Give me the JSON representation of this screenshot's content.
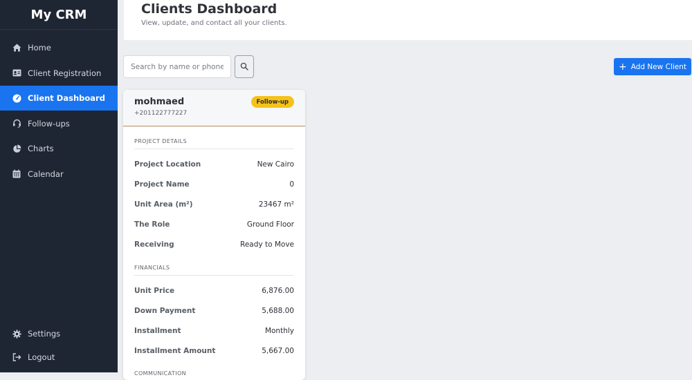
{
  "app": {
    "brand": "My CRM"
  },
  "sidebar": {
    "items": [
      {
        "label": "Home",
        "icon": "home-icon"
      },
      {
        "label": "Client Registration",
        "icon": "id-card-icon"
      },
      {
        "label": "Client Dashboard",
        "icon": "dashboard-icon",
        "active": true
      },
      {
        "label": "Follow-ups",
        "icon": "headset-icon"
      },
      {
        "label": "Charts",
        "icon": "pie-chart-icon"
      },
      {
        "label": "Calendar",
        "icon": "calendar-icon"
      }
    ],
    "bottom": [
      {
        "label": "Settings",
        "icon": "gear-icon"
      },
      {
        "label": "Logout",
        "icon": "logout-icon"
      }
    ]
  },
  "header": {
    "title": "Clients Dashboard",
    "subtitle": "View, update, and contact all your clients."
  },
  "toolbar": {
    "search_placeholder": "Search by name or phone",
    "search_value": "",
    "add_label": "Add New Client"
  },
  "client": {
    "name": "mohmaed",
    "phone": "+201122777227",
    "status": "Follow-up",
    "project_title": "PROJECT DETAILS",
    "project": [
      {
        "label": "Project Location",
        "value": "New Cairo"
      },
      {
        "label": "Project Name",
        "value": "0"
      },
      {
        "label": "Unit Area (m²)",
        "value": "23467 m²"
      },
      {
        "label": "The Role",
        "value": "Ground Floor"
      },
      {
        "label": "Receiving",
        "value": "Ready to Move"
      }
    ],
    "financials_title": "FINANCIALS",
    "financials": [
      {
        "label": "Unit Price",
        "value": "6,876.00"
      },
      {
        "label": "Down Payment",
        "value": "5,688.00"
      },
      {
        "label": "Installment",
        "value": "Monthly"
      },
      {
        "label": "Installment Amount",
        "value": "5,667.00"
      }
    ],
    "communication_title": "COMMUNICATION"
  },
  "colors": {
    "sidebar_bg": "#1f2633",
    "accent": "#1a74f0",
    "badge": "#f5c21b",
    "page_bg": "#eceef1"
  }
}
